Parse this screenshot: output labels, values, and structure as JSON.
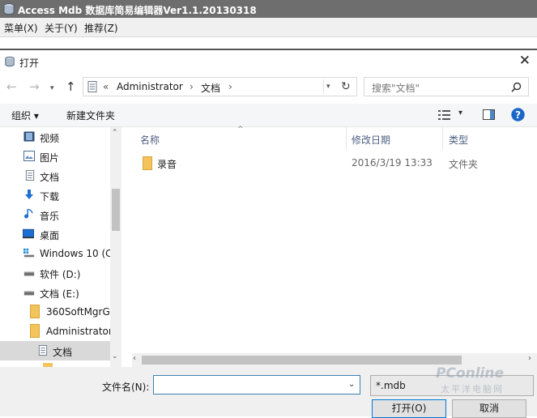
{
  "app": {
    "title": "Access Mdb 数据库简易编辑器Ver1.1.20130318",
    "menu": [
      "菜单(X)",
      "关于(Y)",
      "推荐(Z)"
    ]
  },
  "dialog": {
    "title": "打开",
    "close_glyph": "✕"
  },
  "address": {
    "overflow": "«",
    "crumbs": [
      "Administrator",
      "文档"
    ],
    "search_placeholder": "搜索\"文档\""
  },
  "toolbar": {
    "organize": "组织 ▾",
    "new_folder": "新建文件夹"
  },
  "nav_items": [
    {
      "label": "视频",
      "icon": "video-folder-icon"
    },
    {
      "label": "图片",
      "icon": "pictures-folder-icon"
    },
    {
      "label": "文档",
      "icon": "documents-folder-icon"
    },
    {
      "label": "下载",
      "icon": "download-folder-icon"
    },
    {
      "label": "音乐",
      "icon": "music-folder-icon"
    },
    {
      "label": "桌面",
      "icon": "desktop-folder-icon"
    },
    {
      "label": "Windows 10 (C",
      "icon": "windows-drive-icon"
    },
    {
      "label": "软件 (D:)",
      "icon": "drive-icon"
    },
    {
      "label": "文档 (E:)",
      "icon": "drive-icon"
    },
    {
      "label": "360SoftMgrG",
      "icon": "folder-icon"
    },
    {
      "label": "Administrator",
      "icon": "folder-icon"
    },
    {
      "label": "文档",
      "icon": "documents-folder-icon"
    }
  ],
  "columns": [
    "名称",
    "修改日期",
    "类型"
  ],
  "files": [
    {
      "name": "录音",
      "modified": "2016/3/19 13:33",
      "type": "文件夹"
    }
  ],
  "bottom": {
    "filename_label": "文件名(N):",
    "filename_value": "",
    "filter_value": "*.mdb",
    "open_button": "打开(O)",
    "cancel_button": "取消"
  },
  "watermark": {
    "text": "PConline",
    "sub": "太平洋电脑网"
  },
  "colors": {
    "accent": "#0078d7",
    "folder": "#f3c35c",
    "help": "#1a66c9"
  }
}
